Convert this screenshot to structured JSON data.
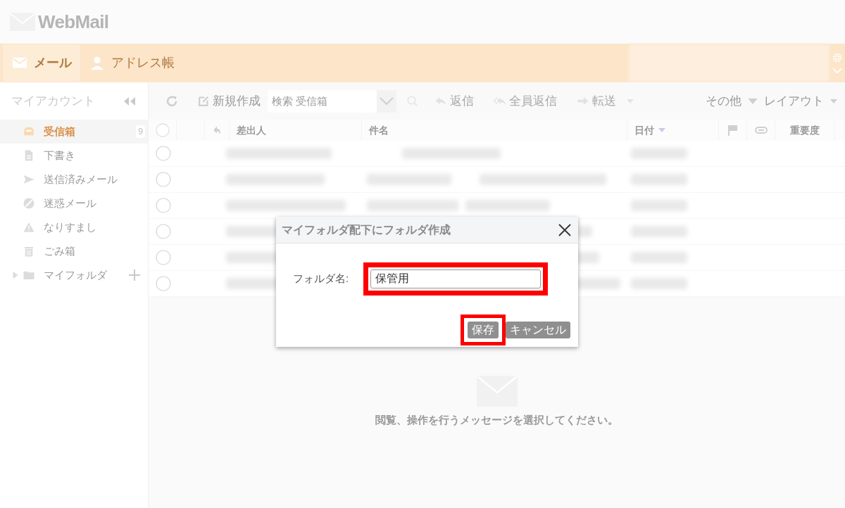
{
  "app": {
    "logo": "WebMail"
  },
  "nav_tabs": [
    {
      "label": "メール",
      "kind": "mail",
      "selected": true
    },
    {
      "label": "アドレス帳",
      "kind": "contacts",
      "selected": false
    }
  ],
  "sidebar": {
    "title": "マイアカウント",
    "folders": [
      {
        "label": "受信箱",
        "kind": "inbox",
        "selected": true,
        "count": "9"
      },
      {
        "label": "下書き",
        "kind": "draft",
        "selected": false
      },
      {
        "label": "送信済みメール",
        "kind": "sent",
        "selected": false
      },
      {
        "label": "迷惑メール",
        "kind": "spam",
        "selected": false
      },
      {
        "label": "なりすまし",
        "kind": "warning",
        "selected": false
      },
      {
        "label": "ごみ箱",
        "kind": "trash",
        "selected": false
      },
      {
        "label": "マイフォルダ",
        "kind": "folder",
        "selected": false,
        "expanded": false
      }
    ]
  },
  "toolbar": {
    "new_label": "新規作成",
    "search": {
      "placeholder": "検索 受信箱"
    },
    "actions": [
      {
        "label": "返信",
        "kind": "reply",
        "disabled": true
      },
      {
        "label": "全員返信",
        "kind": "reply-all",
        "disabled": true
      },
      {
        "label": "転送",
        "kind": "forward",
        "disabled": true
      }
    ],
    "menus": [
      {
        "label": "その他"
      },
      {
        "label": "レイアウト"
      }
    ]
  },
  "table": {
    "columns": [
      {
        "label": "差出人",
        "sorted": false
      },
      {
        "label": "件名",
        "sorted": false
      },
      {
        "label": "日付",
        "sorted": true
      },
      {
        "label": "重要度",
        "sorted": false
      }
    ],
    "select_all": {
      "checked": false
    },
    "rows": [
      {
        "checked": false
      },
      {
        "checked": false
      },
      {
        "checked": false
      },
      {
        "checked": false
      },
      {
        "checked": false
      },
      {
        "checked": false
      }
    ]
  },
  "dialog": {
    "title": "マイフォルダ配下にフォルダ作成",
    "field_label": "フォルダ名:",
    "value": "保管用",
    "field_highlighted": true,
    "buttons": [
      {
        "label": "保存",
        "highlighted": true
      },
      {
        "label": "キャンセル",
        "highlighted": false
      }
    ]
  },
  "empty_state": {
    "message": "閲覧、操作を行うメッセージを選択してください。"
  }
}
